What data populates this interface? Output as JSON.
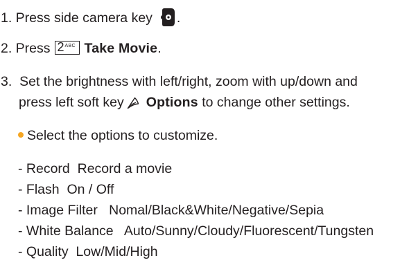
{
  "accent_color": "#f5a623",
  "steps": {
    "s1": {
      "text": "1. Press side camera key",
      "period": "."
    },
    "s2": {
      "prefix": "2. Press",
      "key_digit": "2",
      "key_letters": "ABC",
      "action": "Take Movie",
      "period": "."
    },
    "s3": {
      "line1": "3.  Set the brightness with left/right, zoom with up/down and",
      "line2_prefix": "press left soft key",
      "options_label": "Options",
      "line2_suffix": "to change other settings."
    }
  },
  "bullet_text": "Select the options to customize.",
  "options": [
    {
      "name": "- Record",
      "values": "Record a movie"
    },
    {
      "name": "- Flash",
      "values": "On / Off"
    },
    {
      "name": "- Image Filter",
      "values": "Nomal/Black&White/Negative/Sepia"
    },
    {
      "name": "- White Balance",
      "values": "Auto/Sunny/Cloudy/Fluorescent/Tungsten"
    },
    {
      "name": "- Quality",
      "values": "Low/Mid/High"
    }
  ]
}
